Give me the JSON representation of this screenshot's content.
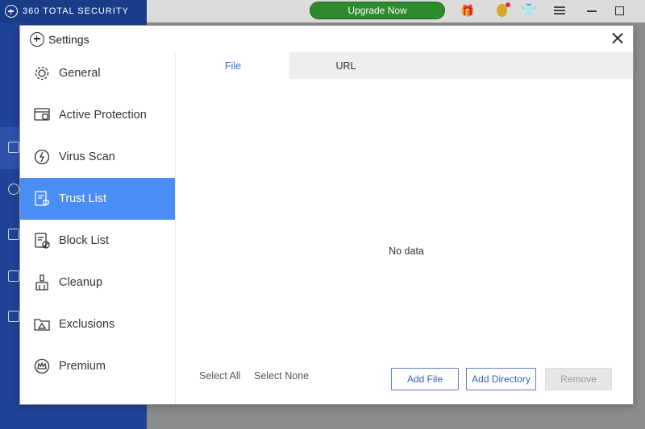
{
  "background_app": {
    "brand": "360 TOTAL SECURITY",
    "upgrade_label": "Upgrade Now",
    "toolbar_icons": [
      "gift-icon",
      "coin-icon",
      "shirt-icon",
      "menu-icon",
      "minimize-icon",
      "maximize-icon"
    ]
  },
  "dialog": {
    "title": "Settings",
    "sidebar": {
      "items": [
        {
          "label": "General",
          "icon": "gear-icon"
        },
        {
          "label": "Active Protection",
          "icon": "protection-icon"
        },
        {
          "label": "Virus Scan",
          "icon": "virus-scan-icon"
        },
        {
          "label": "Trust List",
          "icon": "trust-list-icon",
          "active": true
        },
        {
          "label": "Block List",
          "icon": "block-list-icon"
        },
        {
          "label": "Cleanup",
          "icon": "broom-icon"
        },
        {
          "label": "Exclusions",
          "icon": "folder-icon"
        },
        {
          "label": "Premium",
          "icon": "crown-icon"
        }
      ]
    },
    "tabs": [
      {
        "label": "File",
        "active": true
      },
      {
        "label": "URL",
        "active": false
      }
    ],
    "empty_text": "No data",
    "footer": {
      "select_all": "Select All",
      "select_none": "Select None",
      "add_file": "Add File",
      "add_directory": "Add Directory",
      "remove": "Remove"
    }
  },
  "colors": {
    "accent": "#4a8ef5",
    "brand_blue": "#1f4396",
    "upgrade_green": "#2d8a2d"
  }
}
